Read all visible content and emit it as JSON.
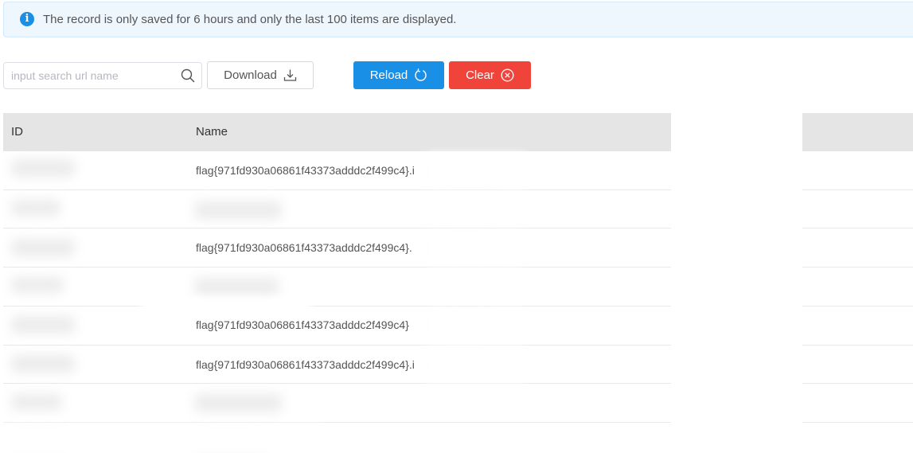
{
  "notice": {
    "icon": "info-icon",
    "text": "The record is only saved for 6 hours and only the last 100 items are displayed."
  },
  "toolbar": {
    "search_placeholder": "input search url name",
    "search_value": "",
    "download_label": "Download",
    "reload_label": "Reload",
    "clear_label": "Clear"
  },
  "colors": {
    "primary": "#1a8fe6",
    "danger": "#f0443b",
    "notice_bg": "#eef6fe",
    "header_bg": "#e5e5e5"
  },
  "table": {
    "columns": [
      "ID",
      "Name"
    ],
    "rows": [
      {
        "id": "",
        "name": "flag{971fd930a06861f43373adddc2f499c4}.i"
      },
      {
        "id": "",
        "name": ""
      },
      {
        "id": "",
        "name": "flag{971fd930a06861f43373adddc2f499c4}."
      },
      {
        "id": "",
        "name": ""
      },
      {
        "id": "",
        "name": "flag{971fd930a06861f43373adddc2f499c4}"
      },
      {
        "id": "",
        "name": "flag{971fd930a06861f43373adddc2f499c4}.i"
      },
      {
        "id": "",
        "name": ""
      },
      {
        "id": "",
        "name": ""
      }
    ]
  }
}
